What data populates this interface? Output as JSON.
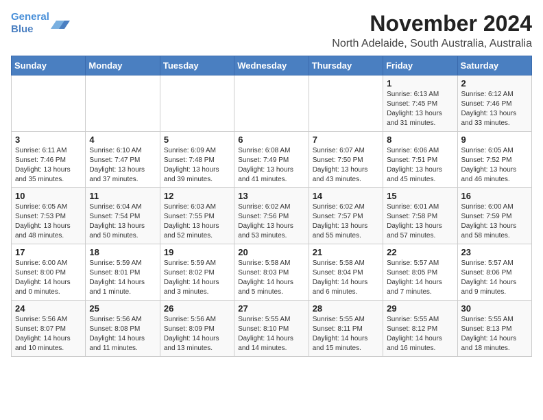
{
  "logo": {
    "line1": "General",
    "line2": "Blue"
  },
  "title": "November 2024",
  "subtitle": "North Adelaide, South Australia, Australia",
  "days_of_week": [
    "Sunday",
    "Monday",
    "Tuesday",
    "Wednesday",
    "Thursday",
    "Friday",
    "Saturday"
  ],
  "weeks": [
    [
      {
        "day": "",
        "info": ""
      },
      {
        "day": "",
        "info": ""
      },
      {
        "day": "",
        "info": ""
      },
      {
        "day": "",
        "info": ""
      },
      {
        "day": "",
        "info": ""
      },
      {
        "day": "1",
        "info": "Sunrise: 6:13 AM\nSunset: 7:45 PM\nDaylight: 13 hours and 31 minutes."
      },
      {
        "day": "2",
        "info": "Sunrise: 6:12 AM\nSunset: 7:46 PM\nDaylight: 13 hours and 33 minutes."
      }
    ],
    [
      {
        "day": "3",
        "info": "Sunrise: 6:11 AM\nSunset: 7:46 PM\nDaylight: 13 hours and 35 minutes."
      },
      {
        "day": "4",
        "info": "Sunrise: 6:10 AM\nSunset: 7:47 PM\nDaylight: 13 hours and 37 minutes."
      },
      {
        "day": "5",
        "info": "Sunrise: 6:09 AM\nSunset: 7:48 PM\nDaylight: 13 hours and 39 minutes."
      },
      {
        "day": "6",
        "info": "Sunrise: 6:08 AM\nSunset: 7:49 PM\nDaylight: 13 hours and 41 minutes."
      },
      {
        "day": "7",
        "info": "Sunrise: 6:07 AM\nSunset: 7:50 PM\nDaylight: 13 hours and 43 minutes."
      },
      {
        "day": "8",
        "info": "Sunrise: 6:06 AM\nSunset: 7:51 PM\nDaylight: 13 hours and 45 minutes."
      },
      {
        "day": "9",
        "info": "Sunrise: 6:05 AM\nSunset: 7:52 PM\nDaylight: 13 hours and 46 minutes."
      }
    ],
    [
      {
        "day": "10",
        "info": "Sunrise: 6:05 AM\nSunset: 7:53 PM\nDaylight: 13 hours and 48 minutes."
      },
      {
        "day": "11",
        "info": "Sunrise: 6:04 AM\nSunset: 7:54 PM\nDaylight: 13 hours and 50 minutes."
      },
      {
        "day": "12",
        "info": "Sunrise: 6:03 AM\nSunset: 7:55 PM\nDaylight: 13 hours and 52 minutes."
      },
      {
        "day": "13",
        "info": "Sunrise: 6:02 AM\nSunset: 7:56 PM\nDaylight: 13 hours and 53 minutes."
      },
      {
        "day": "14",
        "info": "Sunrise: 6:02 AM\nSunset: 7:57 PM\nDaylight: 13 hours and 55 minutes."
      },
      {
        "day": "15",
        "info": "Sunrise: 6:01 AM\nSunset: 7:58 PM\nDaylight: 13 hours and 57 minutes."
      },
      {
        "day": "16",
        "info": "Sunrise: 6:00 AM\nSunset: 7:59 PM\nDaylight: 13 hours and 58 minutes."
      }
    ],
    [
      {
        "day": "17",
        "info": "Sunrise: 6:00 AM\nSunset: 8:00 PM\nDaylight: 14 hours and 0 minutes."
      },
      {
        "day": "18",
        "info": "Sunrise: 5:59 AM\nSunset: 8:01 PM\nDaylight: 14 hours and 1 minute."
      },
      {
        "day": "19",
        "info": "Sunrise: 5:59 AM\nSunset: 8:02 PM\nDaylight: 14 hours and 3 minutes."
      },
      {
        "day": "20",
        "info": "Sunrise: 5:58 AM\nSunset: 8:03 PM\nDaylight: 14 hours and 5 minutes."
      },
      {
        "day": "21",
        "info": "Sunrise: 5:58 AM\nSunset: 8:04 PM\nDaylight: 14 hours and 6 minutes."
      },
      {
        "day": "22",
        "info": "Sunrise: 5:57 AM\nSunset: 8:05 PM\nDaylight: 14 hours and 7 minutes."
      },
      {
        "day": "23",
        "info": "Sunrise: 5:57 AM\nSunset: 8:06 PM\nDaylight: 14 hours and 9 minutes."
      }
    ],
    [
      {
        "day": "24",
        "info": "Sunrise: 5:56 AM\nSunset: 8:07 PM\nDaylight: 14 hours and 10 minutes."
      },
      {
        "day": "25",
        "info": "Sunrise: 5:56 AM\nSunset: 8:08 PM\nDaylight: 14 hours and 11 minutes."
      },
      {
        "day": "26",
        "info": "Sunrise: 5:56 AM\nSunset: 8:09 PM\nDaylight: 14 hours and 13 minutes."
      },
      {
        "day": "27",
        "info": "Sunrise: 5:55 AM\nSunset: 8:10 PM\nDaylight: 14 hours and 14 minutes."
      },
      {
        "day": "28",
        "info": "Sunrise: 5:55 AM\nSunset: 8:11 PM\nDaylight: 14 hours and 15 minutes."
      },
      {
        "day": "29",
        "info": "Sunrise: 5:55 AM\nSunset: 8:12 PM\nDaylight: 14 hours and 16 minutes."
      },
      {
        "day": "30",
        "info": "Sunrise: 5:55 AM\nSunset: 8:13 PM\nDaylight: 14 hours and 18 minutes."
      }
    ]
  ]
}
